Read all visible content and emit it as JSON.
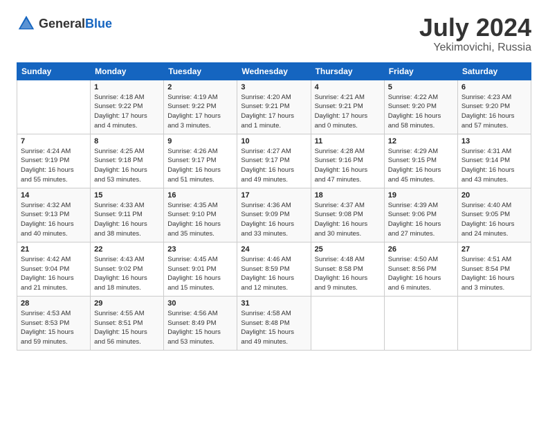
{
  "header": {
    "logo": {
      "general": "General",
      "blue": "Blue"
    },
    "title": "July 2024",
    "subtitle": "Yekimovichi, Russia"
  },
  "weekdays": [
    "Sunday",
    "Monday",
    "Tuesday",
    "Wednesday",
    "Thursday",
    "Friday",
    "Saturday"
  ],
  "weeks": [
    [
      {
        "day": "",
        "info": ""
      },
      {
        "day": "1",
        "info": "Sunrise: 4:18 AM\nSunset: 9:22 PM\nDaylight: 17 hours\nand 4 minutes."
      },
      {
        "day": "2",
        "info": "Sunrise: 4:19 AM\nSunset: 9:22 PM\nDaylight: 17 hours\nand 3 minutes."
      },
      {
        "day": "3",
        "info": "Sunrise: 4:20 AM\nSunset: 9:21 PM\nDaylight: 17 hours\nand 1 minute."
      },
      {
        "day": "4",
        "info": "Sunrise: 4:21 AM\nSunset: 9:21 PM\nDaylight: 17 hours\nand 0 minutes."
      },
      {
        "day": "5",
        "info": "Sunrise: 4:22 AM\nSunset: 9:20 PM\nDaylight: 16 hours\nand 58 minutes."
      },
      {
        "day": "6",
        "info": "Sunrise: 4:23 AM\nSunset: 9:20 PM\nDaylight: 16 hours\nand 57 minutes."
      }
    ],
    [
      {
        "day": "7",
        "info": "Sunrise: 4:24 AM\nSunset: 9:19 PM\nDaylight: 16 hours\nand 55 minutes."
      },
      {
        "day": "8",
        "info": "Sunrise: 4:25 AM\nSunset: 9:18 PM\nDaylight: 16 hours\nand 53 minutes."
      },
      {
        "day": "9",
        "info": "Sunrise: 4:26 AM\nSunset: 9:17 PM\nDaylight: 16 hours\nand 51 minutes."
      },
      {
        "day": "10",
        "info": "Sunrise: 4:27 AM\nSunset: 9:17 PM\nDaylight: 16 hours\nand 49 minutes."
      },
      {
        "day": "11",
        "info": "Sunrise: 4:28 AM\nSunset: 9:16 PM\nDaylight: 16 hours\nand 47 minutes."
      },
      {
        "day": "12",
        "info": "Sunrise: 4:29 AM\nSunset: 9:15 PM\nDaylight: 16 hours\nand 45 minutes."
      },
      {
        "day": "13",
        "info": "Sunrise: 4:31 AM\nSunset: 9:14 PM\nDaylight: 16 hours\nand 43 minutes."
      }
    ],
    [
      {
        "day": "14",
        "info": "Sunrise: 4:32 AM\nSunset: 9:13 PM\nDaylight: 16 hours\nand 40 minutes."
      },
      {
        "day": "15",
        "info": "Sunrise: 4:33 AM\nSunset: 9:11 PM\nDaylight: 16 hours\nand 38 minutes."
      },
      {
        "day": "16",
        "info": "Sunrise: 4:35 AM\nSunset: 9:10 PM\nDaylight: 16 hours\nand 35 minutes."
      },
      {
        "day": "17",
        "info": "Sunrise: 4:36 AM\nSunset: 9:09 PM\nDaylight: 16 hours\nand 33 minutes."
      },
      {
        "day": "18",
        "info": "Sunrise: 4:37 AM\nSunset: 9:08 PM\nDaylight: 16 hours\nand 30 minutes."
      },
      {
        "day": "19",
        "info": "Sunrise: 4:39 AM\nSunset: 9:06 PM\nDaylight: 16 hours\nand 27 minutes."
      },
      {
        "day": "20",
        "info": "Sunrise: 4:40 AM\nSunset: 9:05 PM\nDaylight: 16 hours\nand 24 minutes."
      }
    ],
    [
      {
        "day": "21",
        "info": "Sunrise: 4:42 AM\nSunset: 9:04 PM\nDaylight: 16 hours\nand 21 minutes."
      },
      {
        "day": "22",
        "info": "Sunrise: 4:43 AM\nSunset: 9:02 PM\nDaylight: 16 hours\nand 18 minutes."
      },
      {
        "day": "23",
        "info": "Sunrise: 4:45 AM\nSunset: 9:01 PM\nDaylight: 16 hours\nand 15 minutes."
      },
      {
        "day": "24",
        "info": "Sunrise: 4:46 AM\nSunset: 8:59 PM\nDaylight: 16 hours\nand 12 minutes."
      },
      {
        "day": "25",
        "info": "Sunrise: 4:48 AM\nSunset: 8:58 PM\nDaylight: 16 hours\nand 9 minutes."
      },
      {
        "day": "26",
        "info": "Sunrise: 4:50 AM\nSunset: 8:56 PM\nDaylight: 16 hours\nand 6 minutes."
      },
      {
        "day": "27",
        "info": "Sunrise: 4:51 AM\nSunset: 8:54 PM\nDaylight: 16 hours\nand 3 minutes."
      }
    ],
    [
      {
        "day": "28",
        "info": "Sunrise: 4:53 AM\nSunset: 8:53 PM\nDaylight: 15 hours\nand 59 minutes."
      },
      {
        "day": "29",
        "info": "Sunrise: 4:55 AM\nSunset: 8:51 PM\nDaylight: 15 hours\nand 56 minutes."
      },
      {
        "day": "30",
        "info": "Sunrise: 4:56 AM\nSunset: 8:49 PM\nDaylight: 15 hours\nand 53 minutes."
      },
      {
        "day": "31",
        "info": "Sunrise: 4:58 AM\nSunset: 8:48 PM\nDaylight: 15 hours\nand 49 minutes."
      },
      {
        "day": "",
        "info": ""
      },
      {
        "day": "",
        "info": ""
      },
      {
        "day": "",
        "info": ""
      }
    ]
  ]
}
